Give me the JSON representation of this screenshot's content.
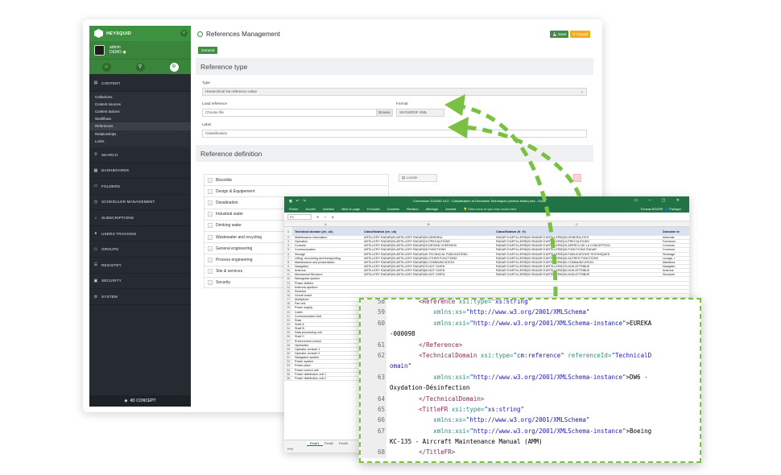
{
  "app": {
    "brand": "HEYSQUID",
    "user_name": "admin",
    "user_org": "DEMO",
    "footer": "4D CONCEPT",
    "page_title": "References Management",
    "save_label": "Save",
    "cancel_label": "Cancel",
    "tab_general": "General",
    "section_type": "Reference type",
    "type_label": "Type",
    "type_value": "Hierarchical list reference value",
    "load_label": "Load reference",
    "load_placeholder": "Choose file",
    "browse_label": "Browse",
    "format_label": "Format",
    "format_value": "SKOS/RDF-XML",
    "label_label": "Label",
    "label_value": "Classification",
    "section_definition": "Reference definition",
    "locale_label": "Locale",
    "accent_color": "#3f9142",
    "sidebar": [
      {
        "label": "CONTENT",
        "icon": "book-icon",
        "sub": [
          "Collections",
          "Content sources",
          "Content actions",
          "Workflows",
          "References",
          "Relationships",
          "Locks"
        ]
      },
      {
        "label": "SEARCH",
        "icon": "search-icon"
      },
      {
        "label": "DASHBOARDS",
        "icon": "dashboard-icon"
      },
      {
        "label": "FOLDERS",
        "icon": "folder-icon"
      },
      {
        "label": "SCHEDULER MANAGEMENT",
        "icon": "clock-icon"
      },
      {
        "label": "SUBSCRIPTIONS",
        "icon": "bell-icon"
      },
      {
        "label": "USERS TRACKING",
        "icon": "user-icon"
      },
      {
        "label": "GROUPS",
        "icon": "group-icon"
      },
      {
        "label": "REGISTRY",
        "icon": "registry-icon"
      },
      {
        "label": "SECURITY",
        "icon": "lock-icon"
      },
      {
        "label": "SYSTEM",
        "icon": "gear-icon"
      }
    ],
    "tree": [
      "Biosolids",
      "Design & Equipement",
      "Desalination",
      "Industrial water",
      "Drinking water",
      "Wastewater and recycling",
      "General engineering",
      "Process engineering",
      "Site & services",
      "Security"
    ]
  },
  "excel": {
    "title": "Conversion S1000D v3.0 - Classification et Domaines Techniques (version finale).xlsx - Excel",
    "ribbon": [
      "Fichier",
      "Accueil",
      "Insertion",
      "Mise en page",
      "Formules",
      "Données",
      "Révision",
      "Affichage",
      "Acrobat"
    ],
    "tell_me": "Dites-nous ce que vous voulez faire",
    "user": "Thomas BOURE",
    "share": "Partager",
    "namebox": "F4",
    "fx": "fx",
    "col_letters": [
      "A",
      "B",
      "C"
    ],
    "headers": [
      "Technical domain (en_uk)",
      "Classification (en_uk)",
      "Classification (fr_fr)",
      "Domaine te"
    ],
    "rows": [
      [
        "Maintenance information",
        "ARTILLERY RADAR|00-ARTILLERY RADAR|00-GENERAL",
        "RADAR D'ARTILLERIE|00-RADAR D'ARTILLERIE|00-GENERALITES",
        "Informati"
      ],
      [
        "Operation",
        "ARTILLERY RADAR|00-ARTILLERY RADAR|10-PRECAUTIONS",
        "RADAR D'ARTILLERIE|00-RADAR D'ARTILLERIE|10-PRECAUTIONS",
        "Fonctionn"
      ],
      [
        "Controls",
        "ARTILLERY RADAR|00-ARTILLERY RADAR|20-DESIGN OVERVIEW",
        "RADAR D'ARTILLERIE|00-RADAR D'ARTILLERIE|20-APERCU DE LA CONCEPTION",
        "Comman"
      ],
      [
        "Communication",
        "ARTILLERY RADAR|00-ARTILLERY RADAR|30-FUNCTIONS",
        "RADAR D'ARTILLERIE|00-RADAR D'ARTILLERIE|30-FONCTIONS RADAR",
        "Commun"
      ],
      [
        "Storage",
        "ARTILLERY RADAR|00-ARTILLERY RADAR|40-TECHNICAL PUBLICATIONS",
        "RADAR D'ARTILLERIE|00-RADAR D'ARTILLERIE|40-PUBLICATIONS TECHNIQUES",
        "Stockage"
      ],
      [
        "Lifting, recovering and transporting",
        "ARTILLERY RADAR|00-ARTILLERY RADAR|50-OTHER FUNCTIONS",
        "RADAR D'ARTILLERIE|00-RADAR D'ARTILLERIE|50-AUTRES FONCTIONS",
        "Levage, r"
      ],
      [
        "Maintenance and presentation",
        "ARTILLERY RADAR|00-ARTILLERY RADAR|60-COMMUNICATION",
        "RADAR D'ARTILLERIE|00-RADAR D'ARTILLERIE|60-COMMUNICATION",
        "Maintena"
      ],
      [
        "Navigation",
        "ARTILLERY RADAR|00-ARTILLERY RADAR|70-NOT GIVEN",
        "RADAR D'ARTILLERIE|00-RADAR D'ARTILLERIE|70-NON ATTRIBUE",
        "Navigatio"
      ],
      [
        "Antenna",
        "ARTILLERY RADAR|00-ARTILLERY RADAR|80-NOT GIVEN",
        "RADAR D'ARTILLERIE|00-RADAR D'ARTILLERIE|80-NON ATTRIBUE",
        "Antenne"
      ],
      [
        "Mechanical Structure",
        "ARTILLERY RADAR|00-ARTILLERY RADAR|90-NOT GIVEN",
        "RADAR D'ARTILLERIE|00-RADAR D'ARTILLERIE|90-NON ATTRIBUE",
        "Structure"
      ],
      [
        "Waveguide system",
        "",
        "",
        ""
      ],
      [
        "Phase shifters",
        "",
        "",
        ""
      ],
      [
        "Antenna aperture",
        "",
        "",
        ""
      ],
      [
        "Receiver",
        "",
        "",
        ""
      ],
      [
        "Circuit board",
        "",
        "",
        ""
      ],
      [
        "Multiplexer",
        "",
        "",
        ""
      ],
      [
        "Fan unit",
        "",
        "",
        ""
      ],
      [
        "Power supply",
        "",
        "",
        ""
      ],
      [
        "Cabin",
        "",
        "",
        ""
      ],
      [
        "Communication Unit",
        "",
        "",
        ""
      ],
      [
        "Rack",
        "",
        "",
        ""
      ],
      [
        "Shelf A",
        "",
        "",
        ""
      ],
      [
        "Shelf B",
        "",
        "",
        ""
      ],
      [
        "Data processing unit",
        "",
        "",
        ""
      ],
      [
        "Shelf C",
        "",
        "",
        ""
      ],
      [
        "Environment control",
        "",
        "",
        ""
      ],
      [
        "Hydraulics",
        "",
        "",
        ""
      ],
      [
        "Operator console 1",
        "",
        "",
        ""
      ],
      [
        "Operator console 2",
        "",
        "",
        ""
      ],
      [
        "Navigation system",
        "",
        "",
        ""
      ],
      [
        "Power system",
        "",
        "",
        ""
      ],
      [
        "Power plant",
        "",
        "",
        ""
      ],
      [
        "Power control unit",
        "",
        "",
        ""
      ],
      [
        "Power distribution unit 1",
        "",
        "",
        ""
      ],
      [
        "Power distribution unit 2",
        "",
        "",
        ""
      ]
    ],
    "sheets": [
      "Feuil1",
      "Feuil2",
      "Feuil3"
    ],
    "status": "Prêt"
  },
  "code": {
    "lines": [
      {
        "n": "58",
        "parts": [
          [
            "tag",
            "        <Reference "
          ],
          [
            "attr",
            "xsi:type="
          ],
          [
            "val",
            "\"xs:string\""
          ]
        ]
      },
      {
        "n": "59",
        "parts": [
          [
            "attr",
            "            xmlns:xs="
          ],
          [
            "val",
            "\"http://www.w3.org/2001/XMLSchema\""
          ]
        ]
      },
      {
        "n": "60",
        "parts": [
          [
            "attr",
            "            xmlns:xsi="
          ],
          [
            "val",
            "\"http://www.w3.org/2001/XMLSchema-instance\""
          ],
          [
            "txt",
            ">EUREKA"
          ]
        ]
      },
      {
        "n": "",
        "parts": [
          [
            "txt",
            "-000098"
          ]
        ]
      },
      {
        "n": "61",
        "parts": [
          [
            "tag",
            "        </Reference>"
          ]
        ]
      },
      {
        "n": "62",
        "parts": [
          [
            "tag",
            "        <TechnicalDomain "
          ],
          [
            "attr",
            "xsi:type="
          ],
          [
            "val",
            "\"cm:reference\" "
          ],
          [
            "attr",
            "referenceId="
          ],
          [
            "val",
            "\"TechnicalD"
          ]
        ]
      },
      {
        "n": "",
        "parts": [
          [
            "val",
            "omain\""
          ]
        ]
      },
      {
        "n": "63",
        "parts": [
          [
            "attr",
            "            xmlns:xsi="
          ],
          [
            "val",
            "\"http://www.w3.org/2001/XMLSchema-instance\""
          ],
          [
            "txt",
            ">DW6 -"
          ]
        ]
      },
      {
        "n": "",
        "parts": [
          [
            "txt",
            "Oxydation-Désinfection"
          ]
        ]
      },
      {
        "n": "64",
        "parts": [
          [
            "tag",
            "        </TechnicalDomain>"
          ]
        ]
      },
      {
        "n": "65",
        "parts": [
          [
            "tag",
            "        <TitleFR "
          ],
          [
            "attr",
            "xsi:type="
          ],
          [
            "val",
            "\"xs:string\""
          ]
        ]
      },
      {
        "n": "66",
        "parts": [
          [
            "attr",
            "            xmlns:xs="
          ],
          [
            "val",
            "\"http://www.w3.org/2001/XMLSchema\""
          ]
        ]
      },
      {
        "n": "67",
        "parts": [
          [
            "attr",
            "            xmlns:xsi="
          ],
          [
            "val",
            "\"http://www.w3.org/2001/XMLSchema-instance\""
          ],
          [
            "txt",
            ">Boeing"
          ]
        ]
      },
      {
        "n": "",
        "parts": [
          [
            "txt",
            "KC-135 - Aircraft Maintenance Manual (AMM)"
          ]
        ]
      },
      {
        "n": "68",
        "parts": [
          [
            "tag",
            "        </TitleFR>"
          ]
        ]
      }
    ]
  }
}
